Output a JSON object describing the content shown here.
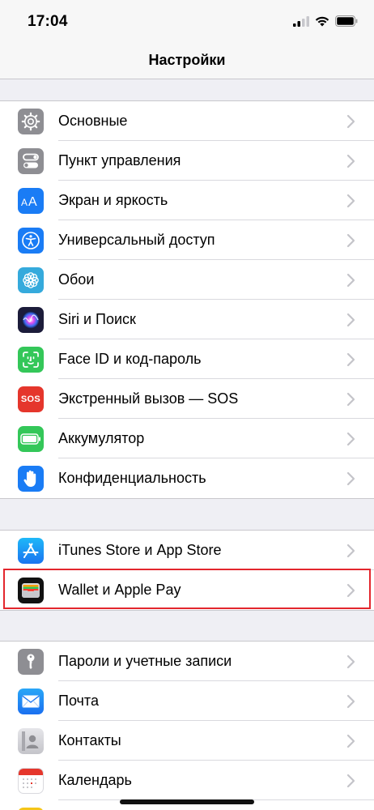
{
  "status_bar": {
    "time": "17:04",
    "icons": [
      "cellular-signal-icon",
      "wifi-icon",
      "battery-icon"
    ]
  },
  "nav": {
    "title": "Настройки"
  },
  "groups": [
    {
      "items": [
        {
          "label": "Основные",
          "icon": "gear-icon",
          "color": "#8e8e93"
        },
        {
          "label": "Пункт управления",
          "icon": "toggles-icon",
          "color": "#8e8e93"
        },
        {
          "label": "Экран и яркость",
          "icon": "text-size-icon",
          "color": "#1a7cf5"
        },
        {
          "label": "Универсальный доступ",
          "icon": "accessibility-icon",
          "color": "#1a7cf5"
        },
        {
          "label": "Обои",
          "icon": "flower-icon",
          "color": "#35aadc"
        },
        {
          "label": "Siri и Поиск",
          "icon": "siri-icon",
          "color": "#1c1c3a"
        },
        {
          "label": "Face ID и код-пароль",
          "icon": "face-id-icon",
          "color": "#34c759"
        },
        {
          "label": "Экстренный вызов — SOS",
          "icon": "sos-icon",
          "color": "#e5362c",
          "icon_text": "SOS"
        },
        {
          "label": "Аккумулятор",
          "icon": "battery-icon",
          "color": "#34c759"
        },
        {
          "label": "Конфиденциальность",
          "icon": "hand-icon",
          "color": "#1a7cf5"
        }
      ]
    },
    {
      "items": [
        {
          "label": "iTunes Store и App Store",
          "icon": "app-store-icon",
          "color": "#1a8cf5"
        },
        {
          "label": "Wallet и Apple Pay",
          "icon": "wallet-icon",
          "color": "#111111"
        }
      ]
    },
    {
      "items": [
        {
          "label": "Пароли и учетные записи",
          "icon": "key-icon",
          "color": "#8e8e93"
        },
        {
          "label": "Почта",
          "icon": "mail-icon",
          "color": "#1a8cf5"
        },
        {
          "label": "Контакты",
          "icon": "contacts-icon",
          "color": "#c7c7cc"
        },
        {
          "label": "Календарь",
          "icon": "calendar-icon",
          "color": "#ffffff"
        }
      ]
    }
  ],
  "highlight": {
    "target": "Wallet и Apple Pay",
    "color": "#e3262d"
  }
}
